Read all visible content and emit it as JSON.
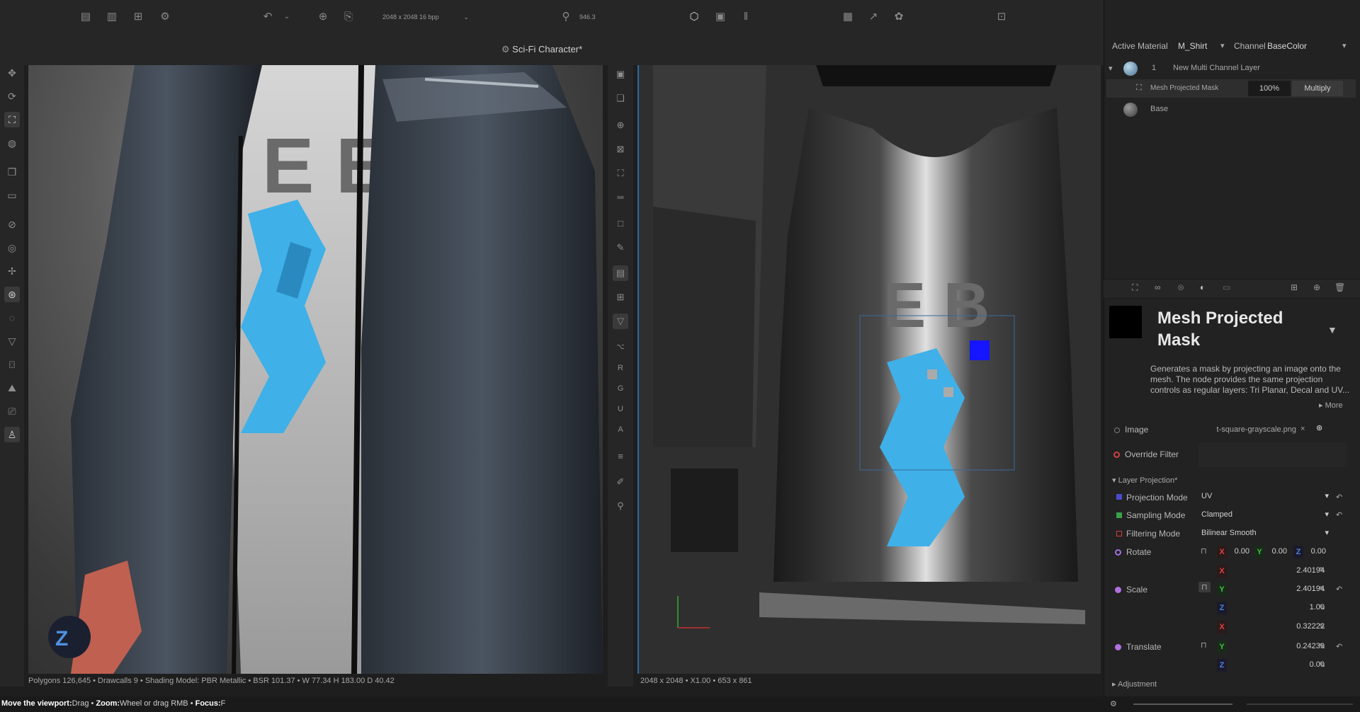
{
  "toolbar": {
    "resolution": "2048 x 2048 16 bpp",
    "zoom_value": "946.3"
  },
  "title": {
    "document": "Sci-Fi Character*"
  },
  "viewport3d": {
    "status": "Polygons 126,645 • Drawcalls 9 • Shading Model: PBR Metallic • BSR 101.37 • W 77.34 H 183.00 D 40.42",
    "shirt_letters": "E E"
  },
  "uv_viewport": {
    "status": "2048 x 2048 • X1.00 • 653 x 861",
    "shirt_letters": "E B",
    "channel_letters": [
      "R",
      "G",
      "U",
      "A"
    ]
  },
  "right_panel": {
    "active_material_label": "Active Material",
    "active_material_value": "M_Shirt",
    "channel_label": "Channel",
    "channel_value": "BaseColor",
    "layer_index": "1",
    "layer_name": "New Multi Channel Layer",
    "mask_row": {
      "name": "Mesh Projected Mask",
      "opacity": "100%",
      "blend": "Multiply"
    },
    "base_layer": "Base",
    "node_title": "Mesh Projected Mask",
    "description": "Generates a mask by projecting an image onto the mesh. The node provides the same projection controls as regular layers: Tri Planar, Decal and UV...",
    "more_label": "More",
    "image_label": "Image",
    "image_value": "t-square-grayscale.png",
    "override_label": "Override Filter",
    "section_label": "Layer Projection*",
    "projection_mode_label": "Projection Mode",
    "projection_mode_value": "UV",
    "sampling_mode_label": "Sampling Mode",
    "sampling_mode_value": "Clamped",
    "filtering_mode_label": "Filtering Mode",
    "filtering_mode_value": "Bilinear Smooth",
    "rotate_label": "Rotate",
    "rotate": {
      "x": "0.00",
      "y": "0.00",
      "z": "0.00"
    },
    "scale_label": "Scale",
    "scale": {
      "x": "2.40194",
      "y": "2.40194",
      "z": "1.00"
    },
    "translate_label": "Translate",
    "translate": {
      "x": "0.32222",
      "y": "0.24239",
      "z": "0.00"
    },
    "adjustment_label": "Adjustment"
  },
  "hint_bar": {
    "move": "Move the viewport:",
    "move_value": "Drag • ",
    "zoom": "Zoom:",
    "zoom_value": "Wheel or drag RMB • ",
    "focus": "Focus:",
    "focus_value": "F"
  },
  "colors": {
    "accent_blue": "#2a6aa0",
    "decal_blue": "#3fb0e8",
    "gizmo_blue": "#1515ff"
  }
}
